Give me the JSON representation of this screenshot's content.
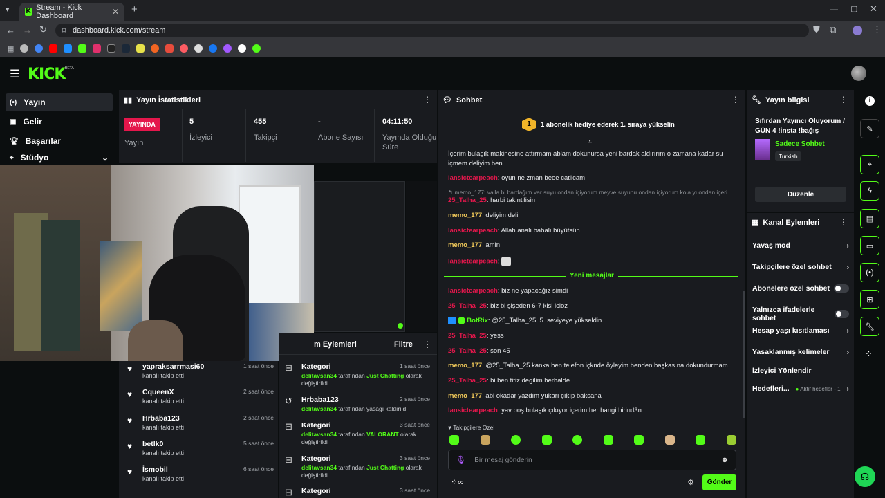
{
  "browser": {
    "tab_title": "Stream - Kick Dashboard",
    "url": "dashboard.kick.com/stream"
  },
  "header": {
    "logo": "KICK",
    "beta": "BETA"
  },
  "sidebar": {
    "items": [
      {
        "label": "Yayın",
        "icon": "broadcast-icon",
        "active": true
      },
      {
        "label": "Gelir",
        "icon": "revenue-icon"
      },
      {
        "label": "Başarılar",
        "icon": "trophy-icon"
      },
      {
        "label": "Stüdyo",
        "icon": "studio-icon"
      }
    ]
  },
  "stats": {
    "title": "Yayın İstatistikleri",
    "live_badge": "YAYINDA",
    "items": [
      {
        "value": "",
        "label": "Yayın"
      },
      {
        "value": "5",
        "label": "İzleyici"
      },
      {
        "value": "455",
        "label": "Takipçi"
      },
      {
        "value": "-",
        "label": "Abone Sayısı"
      },
      {
        "value": "04:11:50",
        "label": "Yayında Olduğu Süre"
      }
    ]
  },
  "followers": {
    "items": [
      {
        "name": "yapraksarrmasi60",
        "sub": "kanalı takip etti",
        "time": "1 saat önce"
      },
      {
        "name": "CqueenX",
        "sub": "kanalı takip etti",
        "time": "2 saat önce"
      },
      {
        "name": "Hrbaba123",
        "sub": "kanalı takip etti",
        "time": "2 saat önce"
      },
      {
        "name": "betlk0",
        "sub": "kanalı takip etti",
        "time": "5 saat önce"
      },
      {
        "name": "İsmobil",
        "sub": "kanalı takip etti",
        "time": "6 saat önce"
      }
    ]
  },
  "moderation": {
    "title": "m Eylemleri",
    "filter": "Filtre",
    "items": [
      {
        "title": "Kategori",
        "user": "delitavsan34",
        "mid": "tarafından",
        "cat": "Just Chatting",
        "end": "olarak değiştirildi",
        "time": "1 saat önce"
      },
      {
        "title": "Hrbaba123",
        "user": "delitavsan34",
        "mid": "tarafından yasağı kaldırıldı",
        "cat": "",
        "end": "",
        "time": "2 saat önce"
      },
      {
        "title": "Kategori",
        "user": "delitavsan34",
        "mid": "tarafından",
        "cat": "VALORANT",
        "end": "olarak değiştirildi",
        "time": "3 saat önce"
      },
      {
        "title": "Kategori",
        "user": "delitavsan34",
        "mid": "tarafından",
        "cat": "Just Chatting",
        "end": "olarak değiştirildi",
        "time": "3 saat önce"
      },
      {
        "title": "Kategori",
        "user": "",
        "mid": "",
        "cat": "",
        "end": "",
        "time": "3 saat önce"
      }
    ]
  },
  "chat": {
    "title": "Sohbet",
    "gift_rank": "1",
    "gift_text": "1 abonelik hediye ederek 1. sıraya yükselin",
    "pinned_text": "İçerim bulaşık makinesine attırmam ablam dokunursa yeni bardak aldırırım o zamana kadar su içmem deliyim ben",
    "reply_text": "memo_177: valla bi bardağım var suyu ondan içiyorum meyve suyunu ondan içiyorum kola yı ondan içeri...",
    "new_messages": "Yeni mesajlar",
    "followers_only": "Takipçilere Özel",
    "placeholder": "Bir mesaj gönderin",
    "send": "Gönder",
    "messages": [
      {
        "user": "lansictearpeach",
        "color": "red",
        "text": "oyun ne zman beee catlicam"
      },
      {
        "user": "25_Talha_25",
        "color": "red",
        "text": "harbi takintilisin"
      },
      {
        "user": "memo_177",
        "color": "yel",
        "text": "deliyim deli"
      },
      {
        "user": "lansictearpeach",
        "color": "red",
        "text": "Allah analı babalı büyütsün"
      },
      {
        "user": "memo_177",
        "color": "yel",
        "text": "amin"
      },
      {
        "user": "lansictearpeach",
        "color": "red",
        "text": ""
      },
      {
        "user": "lansictearpeach",
        "color": "red",
        "text": "biz ne yapacağız simdi"
      },
      {
        "user": "25_Talha_25",
        "color": "red",
        "text": "biz bi şişeden 6-7 kisi icioz"
      },
      {
        "user": "BotRix",
        "color": "bot",
        "text": "@25_Talha_25, 5. seviyeye yükseldin"
      },
      {
        "user": "25_Talha_25",
        "color": "red",
        "text": "yess"
      },
      {
        "user": "25_Talha_25",
        "color": "red",
        "text": "son 45"
      },
      {
        "user": "memo_177",
        "color": "yel",
        "text": "@25_Talha_25 kanka ben telefon içknde öyleyim benden başkasına dokundurmam"
      },
      {
        "user": "25_Talha_25",
        "color": "red",
        "text": "bi ben titiz degilim herhalde"
      },
      {
        "user": "memo_177",
        "color": "yel",
        "text": "abi okadar yazdım yukarı çıkıp baksana"
      },
      {
        "user": "lansictearpeach",
        "color": "red",
        "text": "yav boş bulaşık çıkıyor içerim her hangi birind3n"
      }
    ]
  },
  "stream_info": {
    "title": "Yayın bilgisi",
    "stream_title": "Sıfırdan Yayıncı Oluyorum / GÜN 4 !insta !bağış",
    "category": "Sadece Sohbet",
    "language": "Turkish",
    "edit": "Düzenle"
  },
  "channel_actions": {
    "title": "Kanal Eylemleri",
    "items": [
      {
        "label": "Yavaş mod",
        "control": "chevron"
      },
      {
        "label": "Takipçilere özel sohbet",
        "control": "chevron"
      },
      {
        "label": "Abonelere özel sohbet",
        "control": "toggle"
      },
      {
        "label": "Yalnızca ifadelerle sohbet",
        "control": "toggle"
      },
      {
        "label": "Hesap yaşı kısıtlaması",
        "control": "chevron"
      },
      {
        "label": "Yasaklanmış kelimeler",
        "control": "chevron"
      },
      {
        "label": "İzleyici Yönlendir",
        "control": "none"
      },
      {
        "label": "Hedefleri...",
        "control": "chevron",
        "extra": "Aktif hedefler - 1"
      }
    ]
  },
  "colors": {
    "accent": "#53fc18",
    "live": "#e4174c",
    "panel": "#191b1f",
    "bg": "#0b0e0f"
  }
}
